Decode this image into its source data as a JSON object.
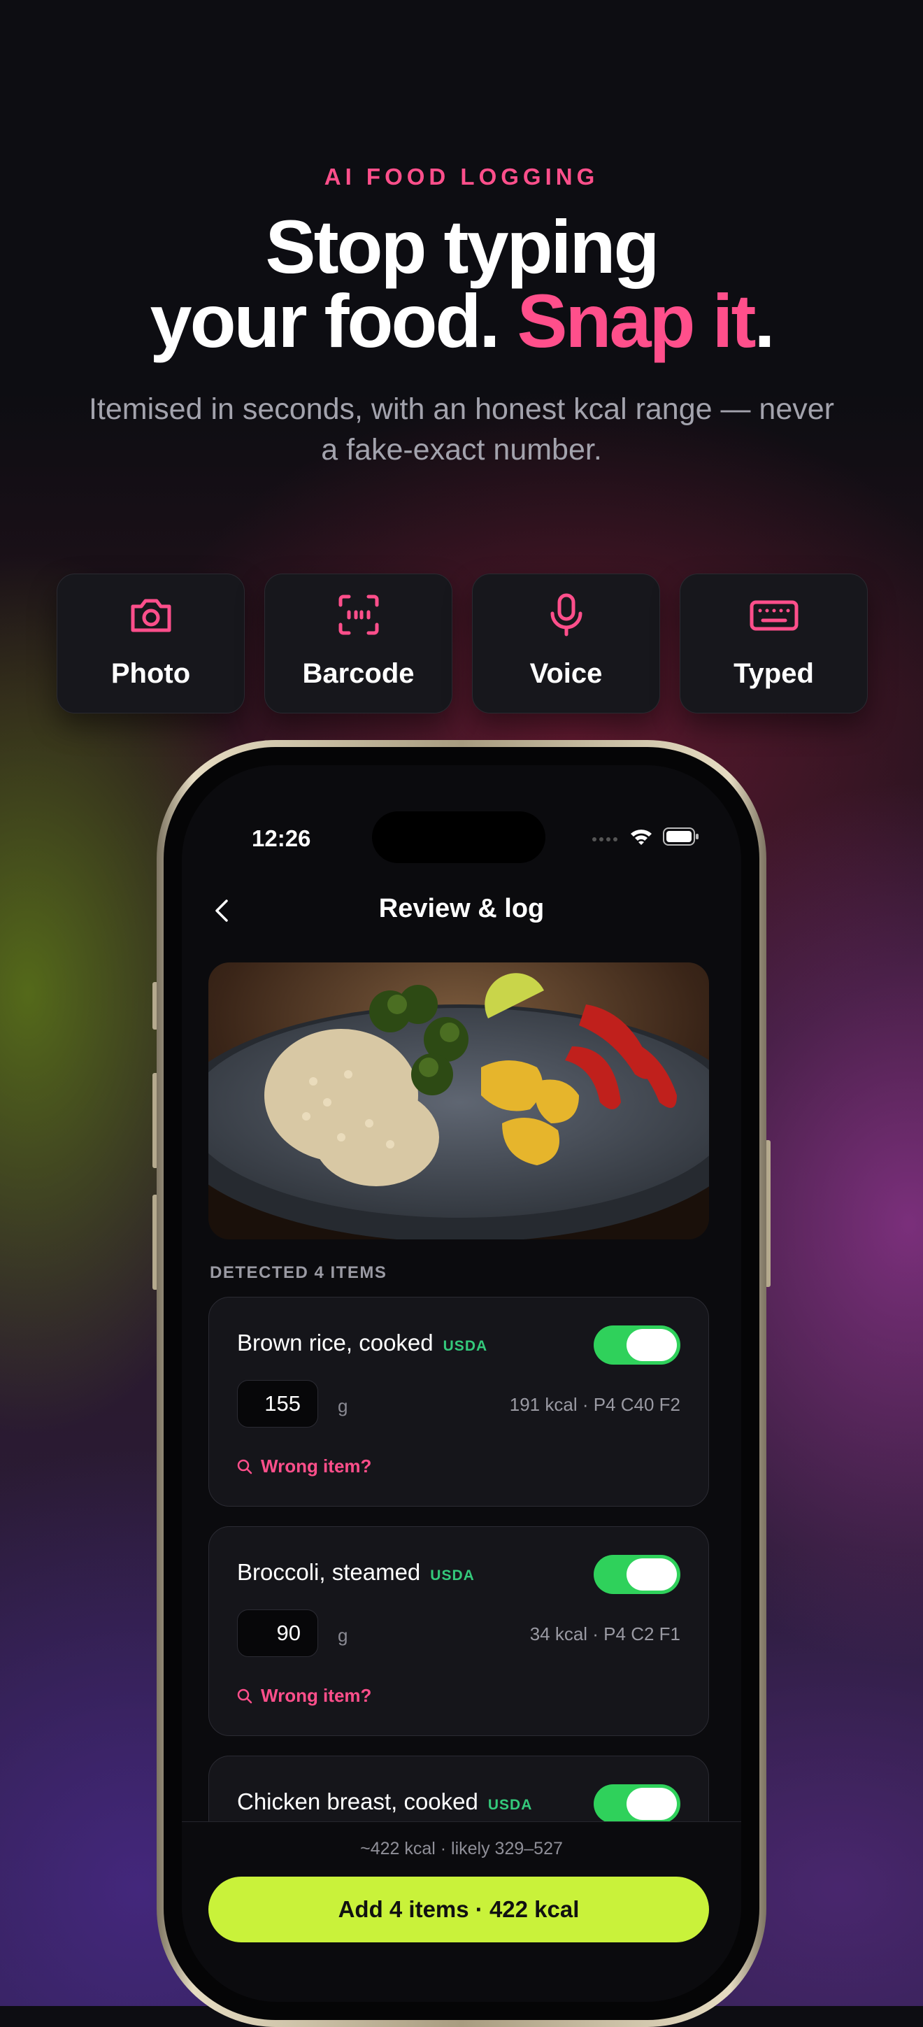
{
  "hero": {
    "eyebrow": "AI FOOD LOGGING",
    "headline_line1": "Stop typing",
    "headline_line2_a": "your food. ",
    "headline_line2_accent": "Snap it",
    "headline_line2_end": ".",
    "subtitle": "Itemised in seconds, with an honest kcal range — never a fake-exact number."
  },
  "modes": [
    {
      "label": "Photo",
      "icon": "camera-icon"
    },
    {
      "label": "Barcode",
      "icon": "barcode-scan-icon"
    },
    {
      "label": "Voice",
      "icon": "microphone-icon"
    },
    {
      "label": "Typed",
      "icon": "keyboard-icon"
    }
  ],
  "phone": {
    "status": {
      "time": "12:26"
    },
    "nav": {
      "title": "Review & log"
    },
    "section_label": "DETECTED 4 ITEMS",
    "items": [
      {
        "name": "Brown rice, cooked",
        "source": "USDA",
        "enabled": true,
        "quantity": "155",
        "unit": "g",
        "macros": "191 kcal · P4 C40 F2",
        "action": "Wrong item?"
      },
      {
        "name": "Broccoli, steamed",
        "source": "USDA",
        "enabled": true,
        "quantity": "90",
        "unit": "g",
        "macros": "34 kcal · P4 C2 F1",
        "action": "Wrong item?"
      },
      {
        "name": "Chicken breast, cooked",
        "source": "USDA",
        "enabled": true
      }
    ],
    "footer": {
      "range": "~422 kcal · likely 329–527",
      "cta": "Add 4 items · 422 kcal"
    }
  },
  "colors": {
    "accent": "#ff4f8b",
    "cta": "#c9f23a",
    "toggle_on": "#2fd15b",
    "source_badge": "#34c97b"
  }
}
